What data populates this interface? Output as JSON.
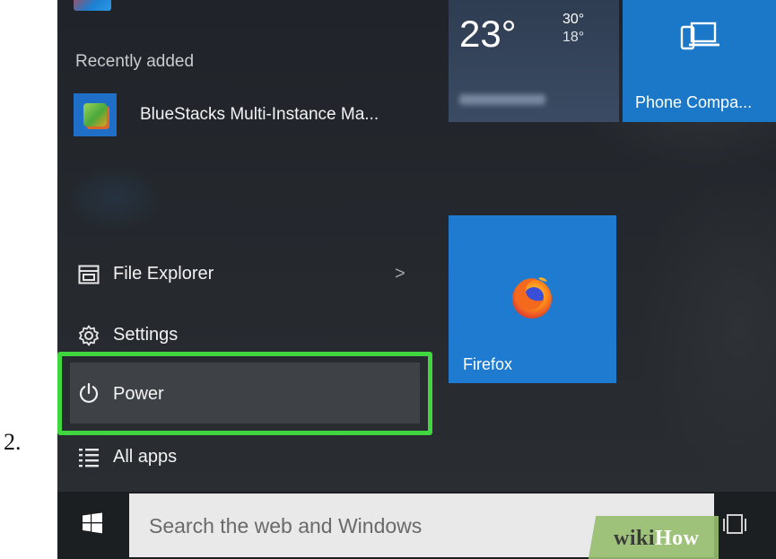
{
  "step_label": "2.",
  "start_menu": {
    "recently_added_heading": "Recently added",
    "recent_apps": [
      {
        "label": "BlueStacks Multi-Instance Ma...",
        "icon": "bluestacks-icon"
      }
    ],
    "nav_items": [
      {
        "label": "File Explorer",
        "icon": "folder-icon",
        "chevron": ">"
      },
      {
        "label": "Settings",
        "icon": "gear-icon"
      },
      {
        "label": "Power",
        "icon": "power-icon",
        "highlighted": true
      },
      {
        "label": "All apps",
        "icon": "list-icon"
      }
    ]
  },
  "tiles": {
    "weather": {
      "temp": "23°",
      "high": "30°",
      "low": "18°"
    },
    "phone_companion": {
      "label": "Phone Compa...",
      "icon": "phone-laptop-icon"
    },
    "firefox": {
      "label": "Firefox",
      "icon": "firefox-logo"
    }
  },
  "taskbar": {
    "search_placeholder": "Search the web and Windows",
    "start_icon": "windows-logo-icon",
    "task_view_icon": "task-view-icon"
  },
  "watermark": {
    "wiki": "wiki",
    "how": "How"
  },
  "colors": {
    "highlight": "#3fd63f",
    "tile_blue": "#1f7bd0",
    "menu_bg": "#23272b"
  }
}
